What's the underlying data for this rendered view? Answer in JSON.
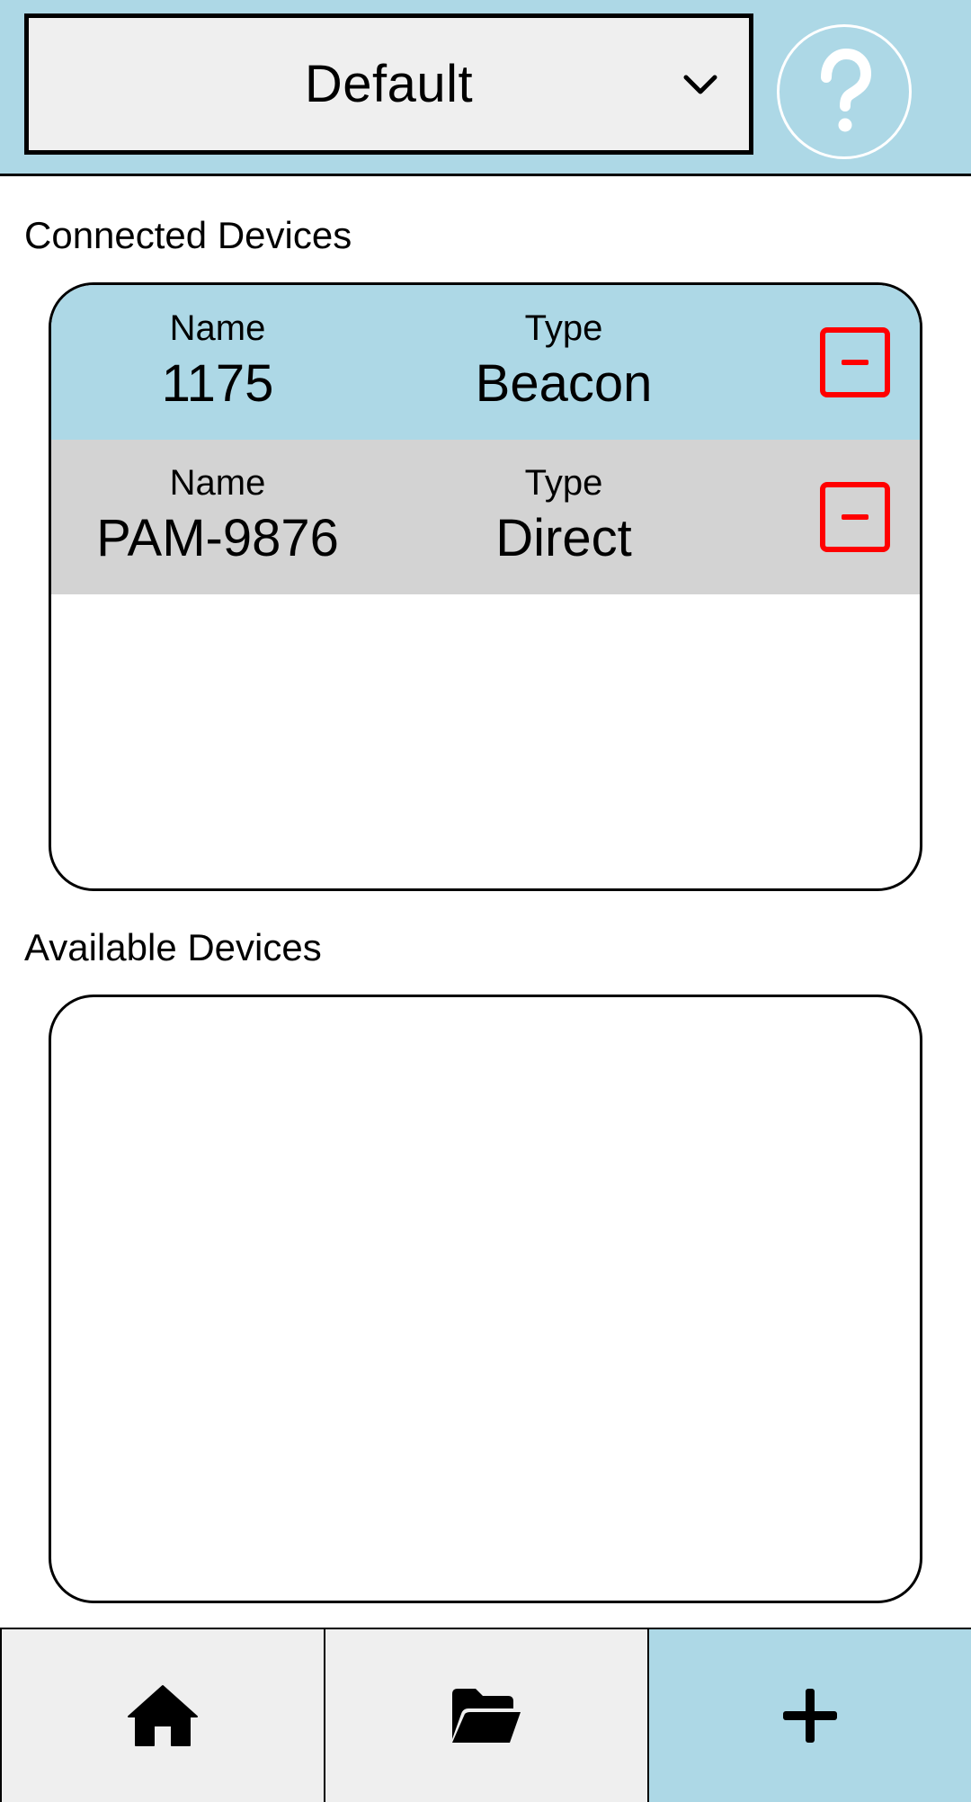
{
  "header": {
    "profile_value": "Default",
    "profile_chevron_icon": "chevron-down-icon",
    "help_icon": "question-mark-icon"
  },
  "connected": {
    "title": "Connected Devices",
    "devices": [
      {
        "name_label": "Name",
        "name": "1175",
        "type_label": "Type",
        "type": "Beacon",
        "selected": true
      },
      {
        "name_label": "Name",
        "name": "PAM-9876",
        "type_label": "Type",
        "type": "Direct",
        "selected": false
      }
    ]
  },
  "available": {
    "title": "Available Devices",
    "devices": []
  },
  "nav": {
    "items": [
      {
        "icon": "home-icon",
        "active": false
      },
      {
        "icon": "folder-open-icon",
        "active": false
      },
      {
        "icon": "plus-icon",
        "active": true
      }
    ]
  },
  "colors": {
    "accent": "#add8e6",
    "row_default": "#d3d3d3",
    "remove": "#ff0000",
    "button_bg": "#efefef"
  }
}
